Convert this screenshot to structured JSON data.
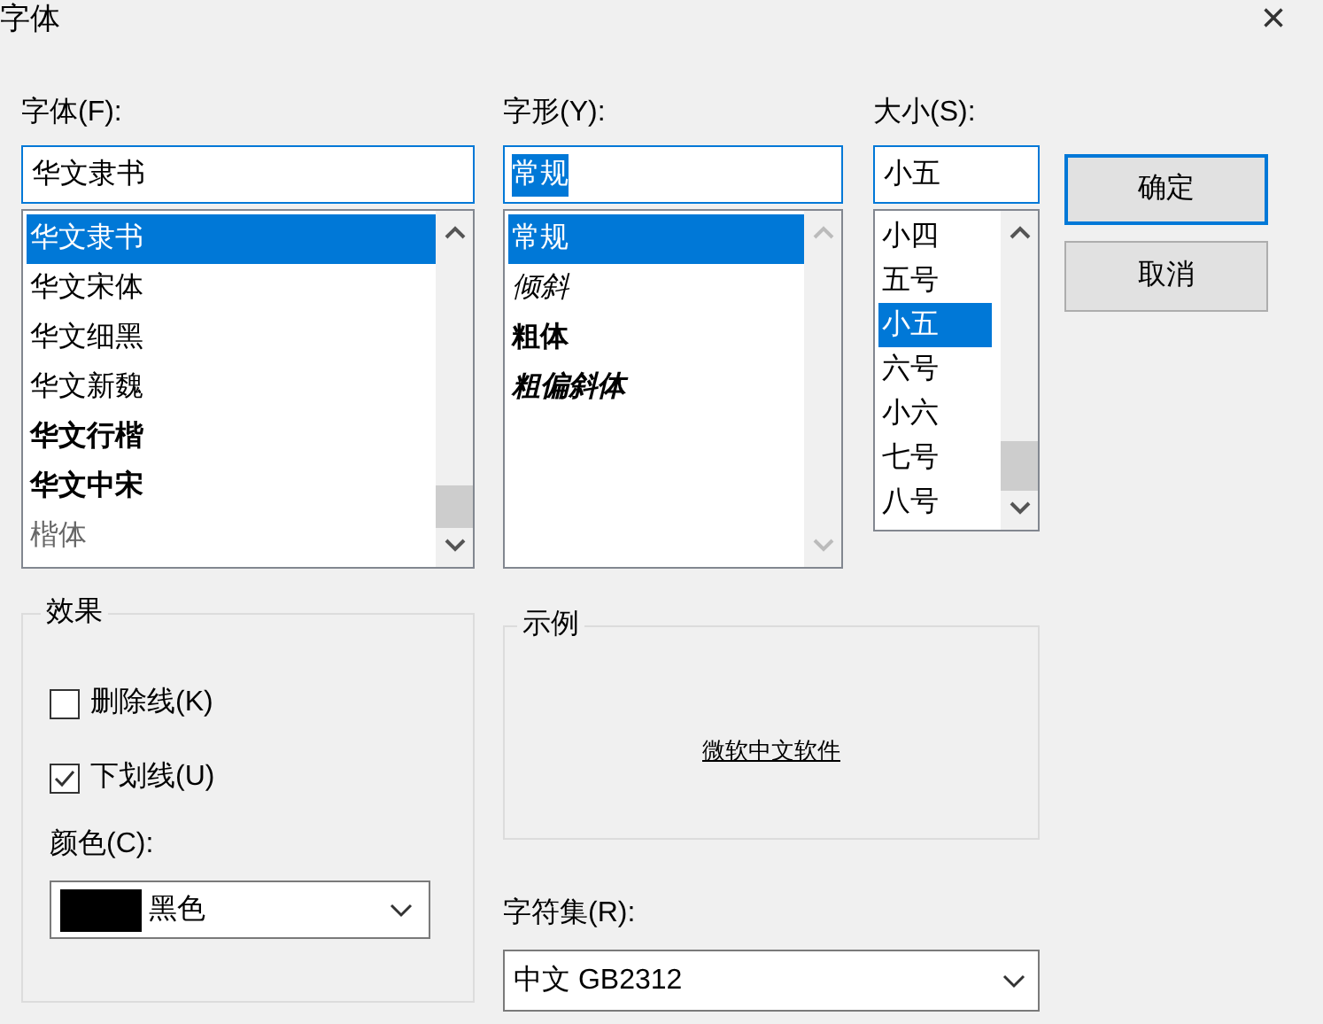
{
  "window": {
    "title": "字体",
    "close": "×"
  },
  "font": {
    "label": "字体(F):",
    "value": "华文隶书",
    "items": [
      {
        "label": "华文隶书",
        "selected": true,
        "kind": "regular"
      },
      {
        "label": "华文宋体",
        "selected": false,
        "kind": "regular"
      },
      {
        "label": "华文细黑",
        "selected": false,
        "kind": "regular"
      },
      {
        "label": "华文新魏",
        "selected": false,
        "kind": "regular"
      },
      {
        "label": "华文行楷",
        "selected": false,
        "kind": "bold"
      },
      {
        "label": "华文中宋",
        "selected": false,
        "kind": "bold"
      },
      {
        "label": "楷体",
        "selected": false,
        "kind": "light"
      }
    ]
  },
  "style": {
    "label": "字形(Y):",
    "value": "常规",
    "items": [
      {
        "label": "常规",
        "selected": true,
        "kind": "regular"
      },
      {
        "label": "倾斜",
        "selected": false,
        "kind": "italic"
      },
      {
        "label": "粗体",
        "selected": false,
        "kind": "bold"
      },
      {
        "label": "粗偏斜体",
        "selected": false,
        "kind": "bold-italic"
      }
    ]
  },
  "size": {
    "label": "大小(S):",
    "value": "小五",
    "items": [
      {
        "label": "小四",
        "selected": false
      },
      {
        "label": "五号",
        "selected": false
      },
      {
        "label": "小五",
        "selected": true
      },
      {
        "label": "六号",
        "selected": false
      },
      {
        "label": "小六",
        "selected": false
      },
      {
        "label": "七号",
        "selected": false
      },
      {
        "label": "八号",
        "selected": false
      }
    ]
  },
  "buttons": [
    {
      "label": "确定",
      "default": true
    },
    {
      "label": "取消",
      "default": false
    }
  ],
  "effects": {
    "title": "效果",
    "options": [
      {
        "label": "删除线(K)",
        "checked": false
      },
      {
        "label": "下划线(U)",
        "checked": true
      }
    ],
    "color_label": "颜色(C):",
    "color": {
      "name": "黑色",
      "color": "#000000"
    }
  },
  "sample": {
    "title": "示例",
    "text": "微软中文软件"
  },
  "charset": {
    "label": "字符集(R):",
    "value": "中文 GB2312"
  }
}
